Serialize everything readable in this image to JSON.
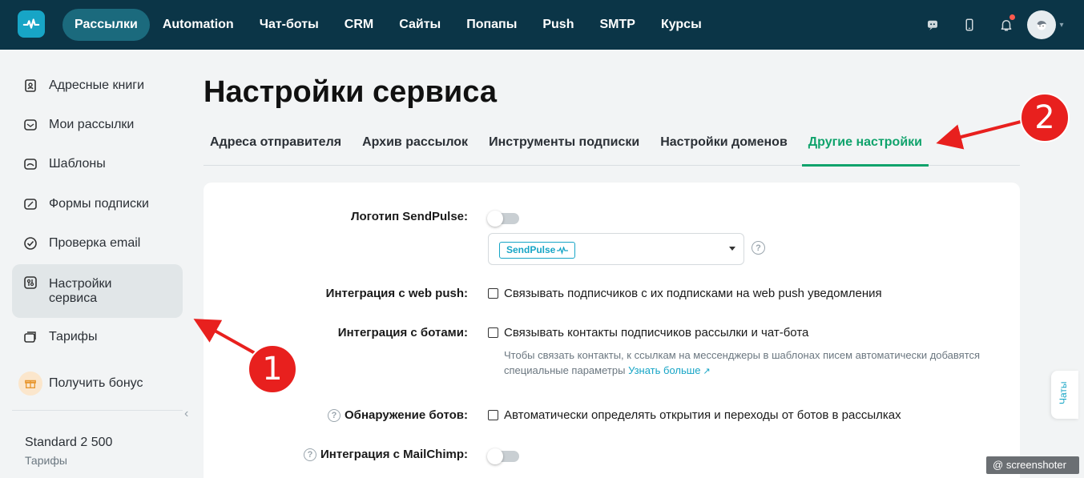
{
  "topnav": {
    "items": [
      "Рассылки",
      "Automation",
      "Чат-боты",
      "CRM",
      "Сайты",
      "Попапы",
      "Push",
      "SMTP",
      "Курсы"
    ],
    "active_index": 0
  },
  "icons": {
    "logo": "pulse-logo-icon",
    "chat": "chat-bot-icon",
    "mobile": "mobile-icon",
    "bell": "bell-icon",
    "avatar": "user-avatar"
  },
  "sidebar": {
    "items": [
      {
        "label": "Адресные книги",
        "icon": "address-book-icon"
      },
      {
        "label": "Мои рассылки",
        "icon": "mailings-icon"
      },
      {
        "label": "Шаблоны",
        "icon": "templates-icon"
      },
      {
        "label": "Формы подписки",
        "icon": "subscription-forms-icon"
      },
      {
        "label": "Проверка email",
        "icon": "email-check-icon"
      },
      {
        "label": "Настройки\nсервиса",
        "icon": "settings-icon"
      },
      {
        "label": "Тарифы",
        "icon": "pricing-icon"
      }
    ],
    "active_index": 5,
    "bonus": "Получить бонус",
    "plan_name": "Standard 2 500",
    "plan_link": "Тарифы"
  },
  "page": {
    "title": "Настройки сервиса",
    "tabs": [
      "Адреса отправителя",
      "Архив рассылок",
      "Инструменты подписки",
      "Настройки доменов",
      "Другие настройки"
    ],
    "active_tab": 4
  },
  "settings": {
    "logo_label": "Логотип SendPulse:",
    "logo_toggle_on": false,
    "logo_select_value": "SendPulse",
    "webpush_label": "Интеграция с web push:",
    "webpush_text": "Связывать подписчиков с их подписками на web push уведомления",
    "webpush_checked": false,
    "bots_label": "Интеграция с ботами:",
    "bots_text": "Связывать контакты подписчиков рассылки и чат-бота",
    "bots_checked": false,
    "bots_hint": "Чтобы связать контакты, к ссылкам на мессенджеры в шаблонах писем автоматически добавятся специальные параметры",
    "bots_hint_link": "Узнать больше",
    "detect_label": "Обнаружение ботов:",
    "detect_text": "Автоматически определять открытия и переходы от ботов в рассылках",
    "detect_checked": false,
    "mailchimp_label": "Интеграция с MailChimp:",
    "mailchimp_toggle_on": false
  },
  "annotations": {
    "one": "1",
    "two": "2"
  },
  "chats_tab": "Чаты",
  "watermark": "screenshoter",
  "colors": {
    "topbar": "#0b3547",
    "accent_green": "#10a36c",
    "accent_teal": "#17a5c6",
    "annotation_red": "#e8201e"
  }
}
